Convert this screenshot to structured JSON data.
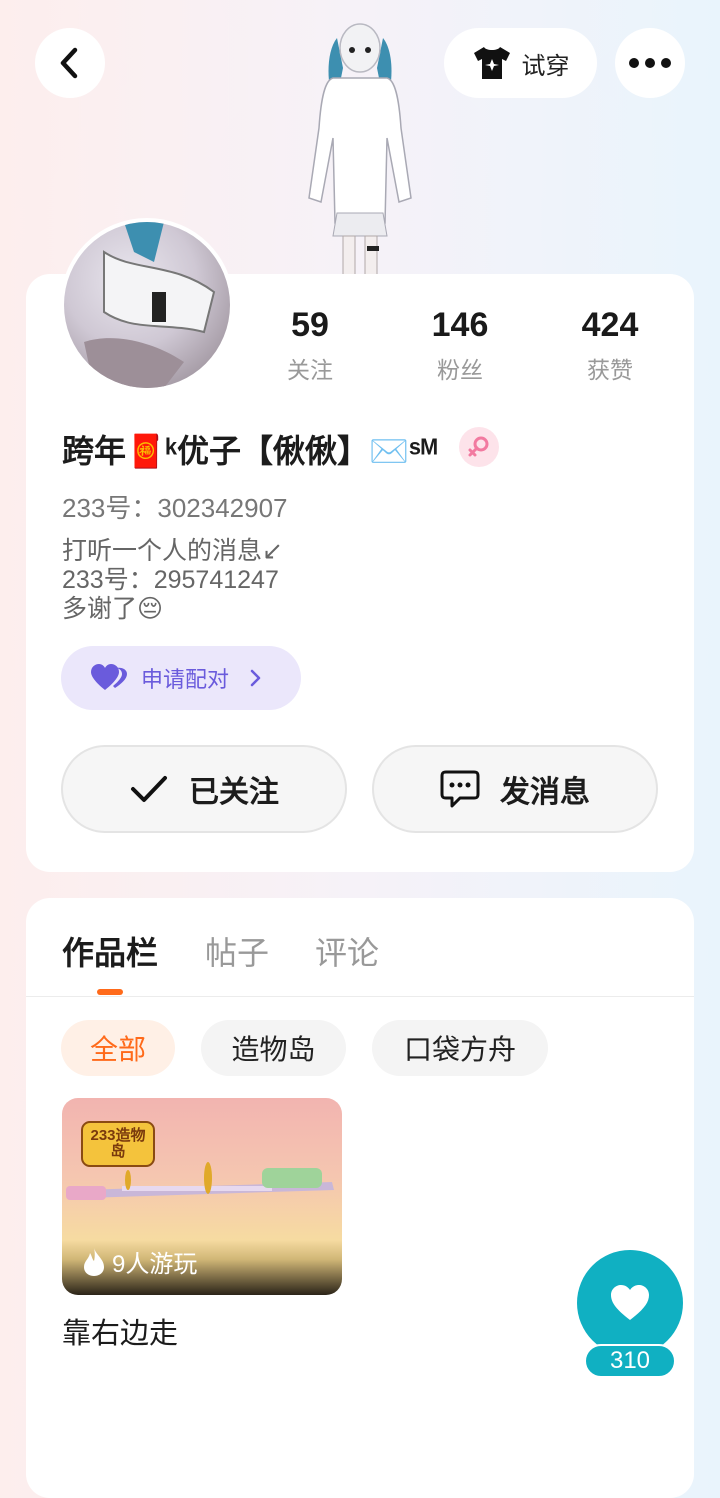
{
  "header": {
    "tryon_label": "试穿"
  },
  "profile": {
    "stats": [
      {
        "value": "59",
        "label": "关注"
      },
      {
        "value": "146",
        "label": "粉丝"
      },
      {
        "value": "424",
        "label": "获赞"
      }
    ],
    "nickname": "跨年🧧ᵏ优子【偢偢】✉️ˢᴹ",
    "id_line": "233号：302342907",
    "bio": "打听一个人的消息↙\n233号：295741247\n多谢了😔",
    "pair_label": "申请配对",
    "follow_label": "已关注",
    "message_label": "发消息"
  },
  "tabs": [
    {
      "label": "作品栏"
    },
    {
      "label": "帖子"
    },
    {
      "label": "评论"
    }
  ],
  "filters": [
    {
      "label": "全部"
    },
    {
      "label": "造物岛"
    },
    {
      "label": "口袋方舟"
    }
  ],
  "works": [
    {
      "title": "靠右边走",
      "players": "9人游玩",
      "logo_text": "233造物岛"
    }
  ],
  "fab": {
    "count": "310"
  },
  "colors": {
    "accent_orange": "#ff6a1a",
    "pair_purple": "#6a5bdc",
    "fab_teal": "#10b0c2"
  }
}
